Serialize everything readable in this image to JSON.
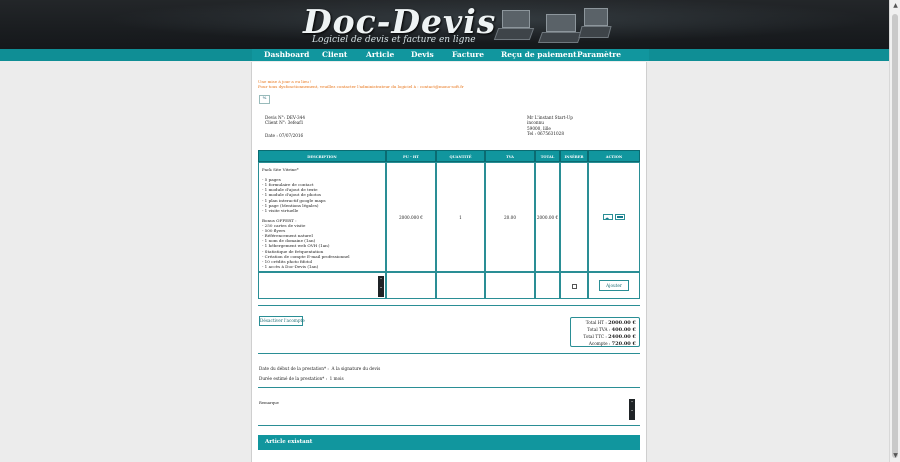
{
  "header": {
    "logo": "Doc-Devis",
    "tagline": "Logiciel de devis et facture en ligne"
  },
  "nav": [
    {
      "label": "Dashboard"
    },
    {
      "label": "Client"
    },
    {
      "label": "Article"
    },
    {
      "label": "Devis"
    },
    {
      "label": "Facture"
    },
    {
      "label": "Reçu de paiement"
    },
    {
      "label": "Paramètre"
    }
  ],
  "notice": {
    "line1": "Une mise à jour a eu lieu !",
    "line2": "Pour tous dysfonctionnement, veuillez contacter l'administrateur du logiciel à : contact@mono-soft.fr"
  },
  "percent_button": "%",
  "quote": {
    "number": "Devis N°: DEV-344",
    "client_number": "Client N°: 3efeaf1",
    "date": "Date : 07/07/2016"
  },
  "recipient": {
    "name": "Mr L'instant Start-Up",
    "city": "inconnu",
    "postal": "59000, lille",
    "phone": "Tel : 0675631028"
  },
  "table": {
    "headers": [
      "DESCRIPTION",
      "PU - HT",
      "QUANTITÉ",
      "TVA",
      "TOTAL",
      "INSÉRER",
      "ACTION"
    ],
    "row": {
      "description": [
        "Pack Site Vitrine*",
        "",
        "- 5 pages",
        "- 1 formulaire de contact",
        "- 1 module d'ajout de texte",
        "- 1 module d'ajout de photos",
        "- 1 plan interactif google maps",
        "- 1 page (Mentions légales)",
        "- 1 visite virtuelle",
        "",
        "Bonus OFFERT :",
        "- 250 cartes de visite",
        "- 500 flyers",
        "- Référencement naturel",
        "- 1 nom de domaine (1an)",
        "- 1 hébergement web OVH (1an)",
        "- Statistique de fréquentation",
        "- Création de compte E-mail professionnel",
        "- 10 crédits photo fifotol",
        "- 1 accès à Doc-Devis (1an)"
      ],
      "pu_ht": "2000.000 €",
      "quantity": "1",
      "tva": "20.00",
      "total": "2000.00 €"
    },
    "add_button": "Ajouter"
  },
  "deactivate_button": "Désactiver l'acompte",
  "totals": {
    "ht_label": "Total HT :",
    "ht": "2000.00 €",
    "tva_label": "Total TVA :",
    "tva": "400.00 €",
    "ttc_label": "Total TTC :",
    "ttc": "2400.00 €",
    "deposit_label": "Acompte :",
    "deposit": "720.00 €"
  },
  "service": {
    "start_label": "Date du début de la prestation* :",
    "start_value": "A la signature du devis",
    "duration_label": "Durée estimé de la prestation* :",
    "duration_value": "1 mois"
  },
  "remarks_placeholder": "Remarque",
  "article_section": "Article existant",
  "colors": {
    "accent": "#11969e",
    "notice": "#e8751a",
    "banner": "#1a1d20"
  }
}
